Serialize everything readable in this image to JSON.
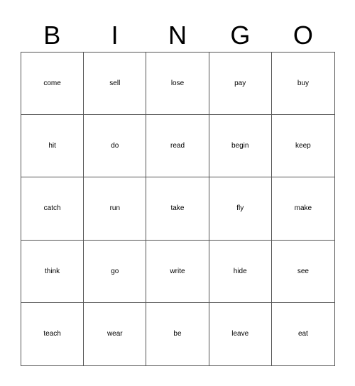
{
  "header": [
    "B",
    "I",
    "N",
    "G",
    "O"
  ],
  "cells": [
    [
      "come",
      "sell",
      "lose",
      "pay",
      "buy"
    ],
    [
      "hit",
      "do",
      "read",
      "begin",
      "keep"
    ],
    [
      "catch",
      "run",
      "take",
      "fly",
      "make"
    ],
    [
      "think",
      "go",
      "write",
      "hide",
      "see"
    ],
    [
      "teach",
      "wear",
      "be",
      "leave",
      "eat"
    ]
  ]
}
